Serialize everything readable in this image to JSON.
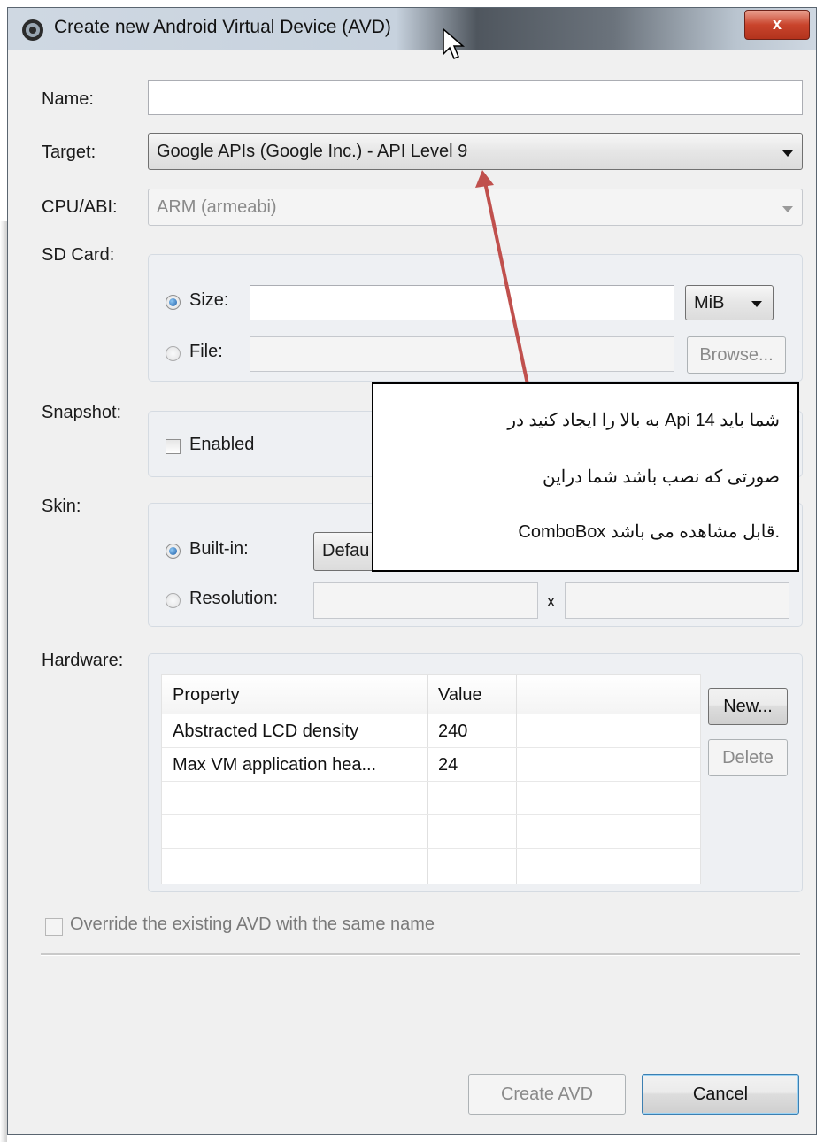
{
  "window": {
    "title": "Create new Android Virtual Device (AVD)",
    "close_label": "x"
  },
  "form": {
    "name": {
      "label": "Name:",
      "value": ""
    },
    "target": {
      "label": "Target:",
      "value": "Google APIs (Google Inc.) - API Level 9"
    },
    "cpu": {
      "label": "CPU/ABI:",
      "value": "ARM (armeabi)"
    },
    "sdcard": {
      "label": "SD Card:",
      "size_label": "Size:",
      "size_value": "",
      "unit": "MiB",
      "file_label": "File:",
      "file_value": "",
      "browse_label": "Browse..."
    },
    "snapshot": {
      "label": "Snapshot:",
      "enabled_label": "Enabled"
    },
    "skin": {
      "label": "Skin:",
      "builtin_label": "Built-in:",
      "builtin_value": "Defau",
      "resolution_label": "Resolution:",
      "x_label": "x"
    },
    "hardware": {
      "label": "Hardware:",
      "columns": [
        "Property",
        "Value"
      ],
      "rows": [
        {
          "property": "Abstracted LCD density",
          "value": "240"
        },
        {
          "property": "Max VM application hea...",
          "value": "24"
        }
      ],
      "new_label": "New...",
      "delete_label": "Delete"
    },
    "override_label": "Override the existing AVD with the same name"
  },
  "buttons": {
    "create": "Create AVD",
    "cancel": "Cancel"
  },
  "annotation": {
    "lines": [
      "شما باید Api 14 به بالا را  ایجاد کنید در",
      "صورتی که نصب باشد شما  دراین",
      "ComboBox قابل مشاهده می باشد."
    ]
  },
  "colors": {
    "arrow": "#c0504d",
    "close_button": "#c9442c"
  }
}
